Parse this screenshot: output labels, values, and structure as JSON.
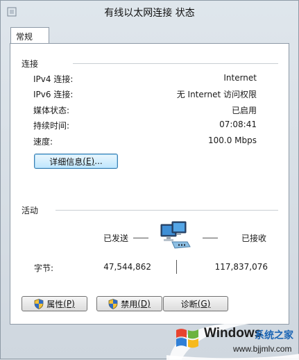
{
  "window": {
    "title": "有线以太网连接 状态"
  },
  "tabs": [
    {
      "label": "常规",
      "selected": true
    }
  ],
  "connection": {
    "group_label": "连接",
    "rows": [
      {
        "label": "IPv4 连接:",
        "value": "Internet"
      },
      {
        "label": "IPv6 连接:",
        "value": "无 Internet 访问权限"
      },
      {
        "label": "媒体状态:",
        "value": "已启用"
      },
      {
        "label": "持续时间:",
        "value": "07:08:41"
      },
      {
        "label": "速度:",
        "value": "100.0 Mbps"
      }
    ],
    "details_button": {
      "text": "详细信息",
      "mnemonic": "(E)",
      "suffix": "..."
    }
  },
  "activity": {
    "group_label": "活动",
    "sent_label": "已发送",
    "received_label": "已接收",
    "bytes_label": "字节:",
    "bytes_sent": "47,544,862",
    "bytes_received": "117,837,076",
    "icon": "network-computers-icon"
  },
  "buttons": {
    "properties": {
      "text": "属性",
      "mnemonic": "(P)"
    },
    "disable": {
      "text": "禁用",
      "mnemonic": "(D)"
    },
    "diagnose": {
      "text": "诊断",
      "mnemonic": "(G)"
    }
  },
  "watermark": {
    "brand": "Windows",
    "tagline": "系统之家",
    "url": "www.bjjmlv.com"
  },
  "colors": {
    "accent": "#3c7fb1",
    "panel": "#ffffff",
    "watermark_cn": "#1a64b4"
  }
}
